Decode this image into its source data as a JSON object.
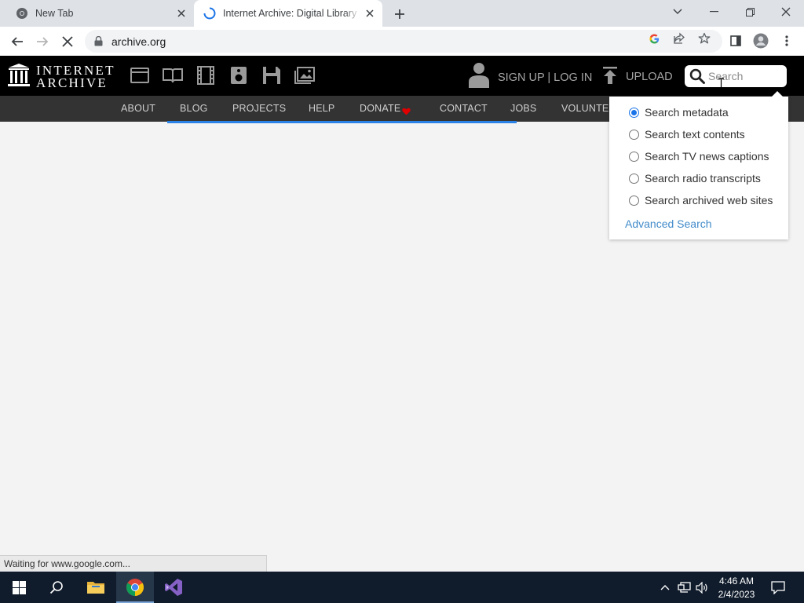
{
  "browser": {
    "tabs": [
      {
        "title": "New Tab",
        "icon": "chrome-icon"
      },
      {
        "title": "Internet Archive: Digital Library of Free & Borrowable Books, Movies, Music & Wayback Machine",
        "icon": "loading-spinner-icon"
      }
    ],
    "url": "archive.org",
    "status_text": "Waiting for www.google.com..."
  },
  "ia": {
    "logo_line1": "INTERNET",
    "logo_line2": "ARCHIVE",
    "media_icons": [
      "web-icon",
      "texts-icon",
      "video-icon",
      "audio-icon",
      "software-icon",
      "images-icon"
    ],
    "signup_label": "SIGN UP | LOG IN",
    "upload_label": "UPLOAD",
    "search_placeholder": "Search",
    "nav": [
      "ABOUT",
      "BLOG",
      "PROJECTS",
      "HELP",
      "DONATE",
      "CONTACT",
      "JOBS",
      "VOLUNTEER"
    ],
    "donate_heart_color": "#e00000"
  },
  "search_dropdown": {
    "options": [
      {
        "label": "Search metadata",
        "checked": true
      },
      {
        "label": "Search text contents",
        "checked": false
      },
      {
        "label": "Search TV news captions",
        "checked": false
      },
      {
        "label": "Search radio transcripts",
        "checked": false
      },
      {
        "label": "Search archived web sites",
        "checked": false
      }
    ],
    "advanced_label": "Advanced Search"
  },
  "taskbar": {
    "time": "4:46 AM",
    "date": "2/4/2023"
  },
  "colors": {
    "accent_blue": "#1a73e8",
    "link_blue": "#428bca",
    "ia_header": "#000000",
    "ia_nav": "#333333"
  }
}
